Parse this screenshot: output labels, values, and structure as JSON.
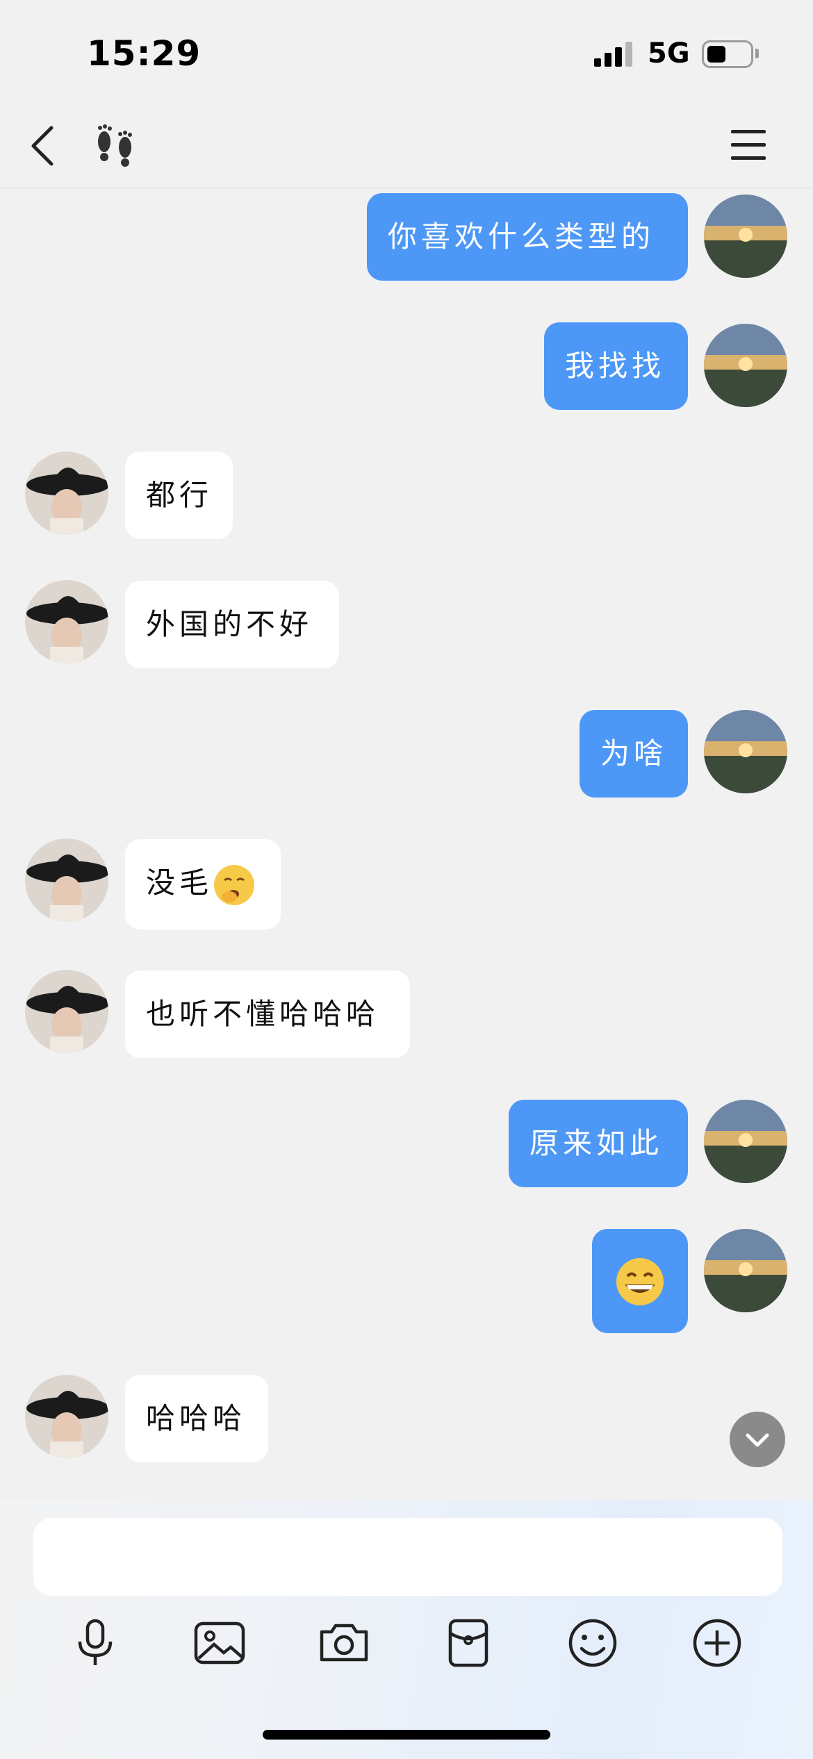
{
  "status_bar": {
    "time": "15:29",
    "network": "5G",
    "battery_level": 0.35
  },
  "nav": {
    "back_icon": "back-chevron-icon",
    "title_icon": "footprint-icon",
    "menu_icon": "menu-icon"
  },
  "messages": [
    {
      "side": "out",
      "text": "你喜欢什么类型的"
    },
    {
      "side": "out",
      "text": "我找找"
    },
    {
      "side": "in",
      "text": "都行"
    },
    {
      "side": "in",
      "text": "外国的不好"
    },
    {
      "side": "out",
      "text": "为啥"
    },
    {
      "side": "in",
      "text": "没毛",
      "emoji": "yawning-face-emoji"
    },
    {
      "side": "in",
      "text": "也听不懂哈哈哈"
    },
    {
      "side": "out",
      "text": "原来如此"
    },
    {
      "side": "out",
      "emoji": "grinning-face-emoji"
    },
    {
      "side": "in",
      "text": "哈哈哈"
    }
  ],
  "input": {
    "placeholder": ""
  },
  "toolbar": [
    "microphone-icon",
    "image-icon",
    "camera-icon",
    "red-packet-icon",
    "emoji-icon",
    "add-icon"
  ],
  "colors": {
    "outgoing_bubble": "#4d98f6",
    "incoming_bubble": "#ffffff",
    "background": "#f1f1f1"
  }
}
